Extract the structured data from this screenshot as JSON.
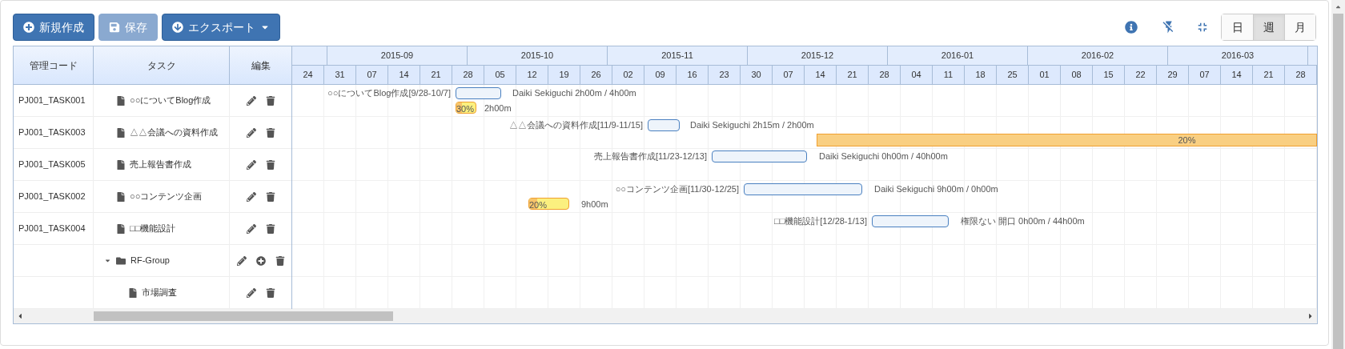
{
  "toolbar": {
    "buttons": [
      {
        "kind": "new",
        "label": "新規作成",
        "disabled": false
      },
      {
        "kind": "save",
        "label": "保存",
        "disabled": true
      },
      {
        "kind": "export",
        "label": "エクスポート",
        "disabled": false
      }
    ],
    "view_modes": [
      {
        "label": "日",
        "selected": false
      },
      {
        "label": "週",
        "selected": true
      },
      {
        "label": "月",
        "selected": false
      }
    ]
  },
  "table": {
    "columns": [
      "管理コード",
      "タスク",
      "編集"
    ],
    "rows": [
      {
        "kind": "task",
        "code": "PJ001_TASK001",
        "name": "○○についてBlog作成"
      },
      {
        "kind": "task",
        "code": "PJ001_TASK003",
        "name": "△△会議への資料作成"
      },
      {
        "kind": "task",
        "code": "PJ001_TASK005",
        "name": "売上報告書作成"
      },
      {
        "kind": "task",
        "code": "PJ001_TASK002",
        "name": "○○コンテンツ企画"
      },
      {
        "kind": "task",
        "code": "PJ001_TASK004",
        "name": "□□機能設計"
      },
      {
        "kind": "group",
        "name": "RF-Group",
        "expanded": true,
        "children": [
          {
            "kind": "task",
            "name": "市場調査"
          }
        ]
      }
    ]
  },
  "timeline": {
    "months": [
      "2015-09",
      "2015-10",
      "2015-11",
      "2015-12",
      "2016-01",
      "2016-02",
      "2016-03"
    ],
    "weeks": [
      "24",
      "31",
      "07",
      "14",
      "21",
      "28",
      "05",
      "12",
      "19",
      "26",
      "02",
      "09",
      "16",
      "23",
      "30",
      "07",
      "14",
      "21",
      "28",
      "04",
      "11",
      "18",
      "25",
      "01",
      "08",
      "15",
      "22",
      "29",
      "07",
      "14",
      "21",
      "28"
    ],
    "bars": [
      {
        "label": "○○についてBlog作成[9/28-10/7]",
        "summary": "Daiki Sekiguchi 2h00m / 4h00m",
        "progress": {
          "label": "30%",
          "level": 0.3,
          "note": "2h00m"
        }
      },
      {
        "label": "△△会議への資料作成[11/9-11/15]",
        "summary": "Daiki Sekiguchi 2h15m / 2h00m",
        "long_bar": {
          "label": "20%"
        }
      },
      {
        "label": "売上報告書作成[11/23-12/13]",
        "summary": "Daiki Sekiguchi 0h00m / 40h00m"
      },
      {
        "label": "○○コンテンツ企画[11/30-12/25]",
        "summary": "Daiki Sekiguchi 9h00m / 0h00m",
        "progress": {
          "label": "20%",
          "level": 0.2,
          "note": "9h00m"
        }
      },
      {
        "label": "□□機能設計[12/28-1/13]",
        "summary": "権限ない 開口 0h00m / 44h00m"
      }
    ]
  }
}
